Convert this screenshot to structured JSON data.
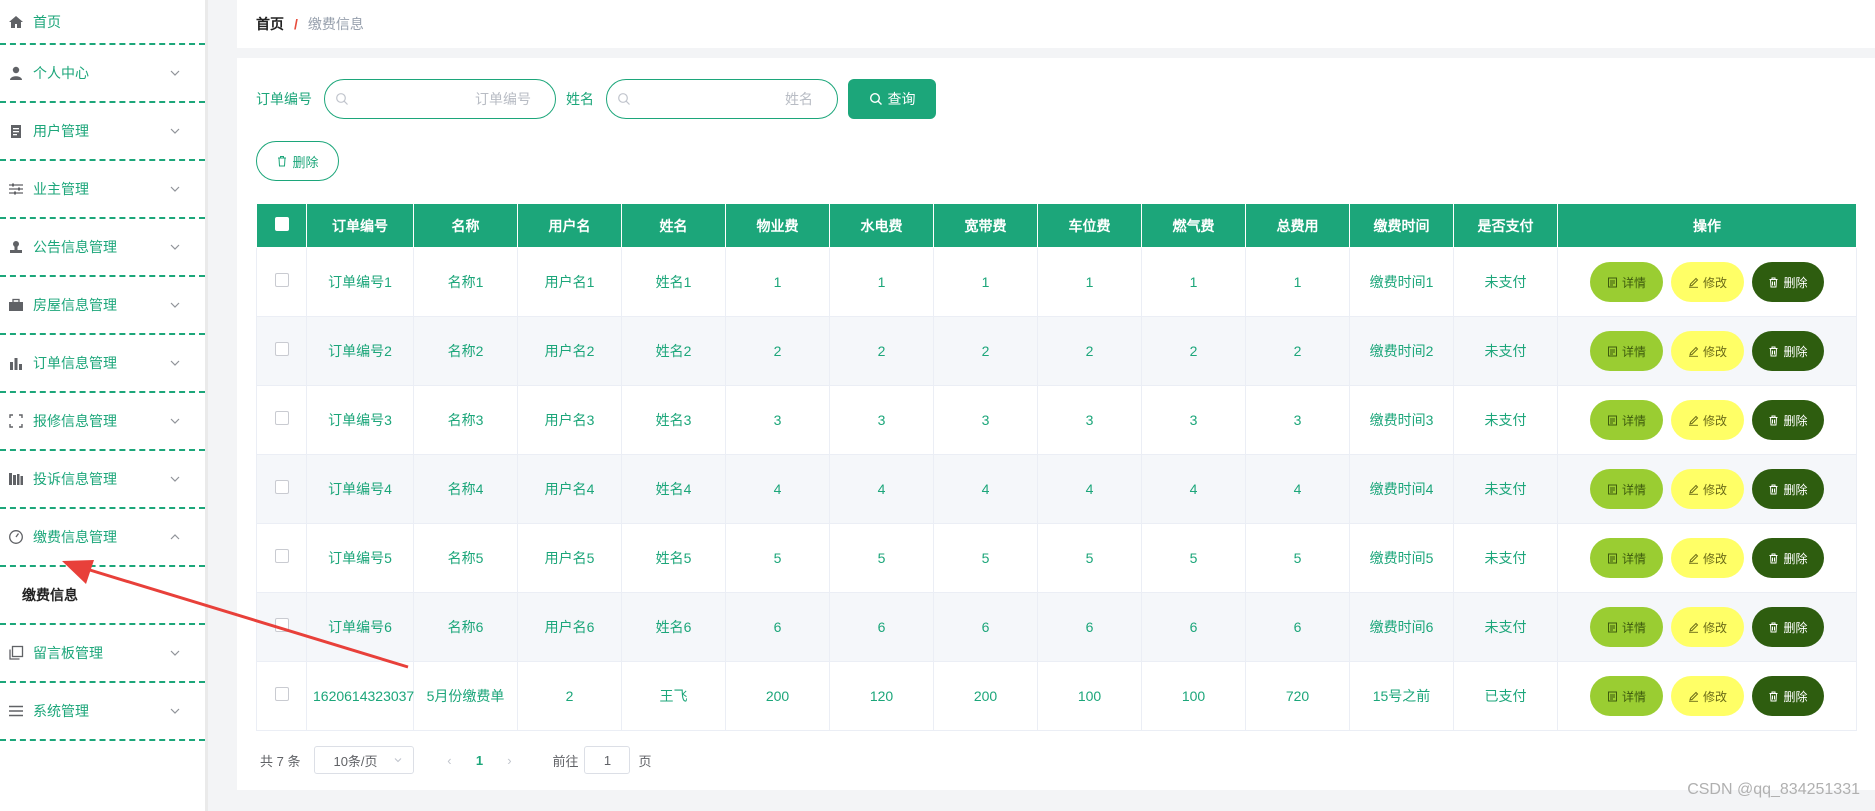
{
  "sidebar": {
    "items": [
      {
        "label": "首页",
        "icon": "home-icon"
      },
      {
        "label": "个人中心",
        "icon": "user-icon"
      },
      {
        "label": "用户管理",
        "icon": "clipboard-icon"
      },
      {
        "label": "业主管理",
        "icon": "sliders-icon"
      },
      {
        "label": "公告信息管理",
        "icon": "stamp-icon"
      },
      {
        "label": "房屋信息管理",
        "icon": "briefcase-icon"
      },
      {
        "label": "订单信息管理",
        "icon": "bar-chart-icon"
      },
      {
        "label": "报修信息管理",
        "icon": "crop-frame-icon"
      },
      {
        "label": "投诉信息管理",
        "icon": "books-icon"
      },
      {
        "label": "缴费信息管理",
        "icon": "gauge-icon"
      },
      {
        "label": "留言板管理",
        "icon": "copy-icon"
      },
      {
        "label": "系统管理",
        "icon": "list-icon"
      }
    ],
    "submenu": {
      "label": "缴费信息"
    }
  },
  "breadcrumb": {
    "home": "首页",
    "separator": "/",
    "current": "缴费信息"
  },
  "search": {
    "order_label": "订单编号",
    "order_placeholder": "订单编号",
    "name_label": "姓名",
    "name_placeholder": "姓名",
    "query_button": "查询"
  },
  "toolbar": {
    "delete_label": "删除"
  },
  "table": {
    "columns": [
      "订单编号",
      "名称",
      "用户名",
      "姓名",
      "物业费",
      "水电费",
      "宽带费",
      "车位费",
      "燃气费",
      "总费用",
      "缴费时间",
      "是否支付",
      "操作"
    ],
    "rows": [
      [
        "订单编号1",
        "名称1",
        "用户名1",
        "姓名1",
        "1",
        "1",
        "1",
        "1",
        "1",
        "1",
        "缴费时间1",
        "未支付"
      ],
      [
        "订单编号2",
        "名称2",
        "用户名2",
        "姓名2",
        "2",
        "2",
        "2",
        "2",
        "2",
        "2",
        "缴费时间2",
        "未支付"
      ],
      [
        "订单编号3",
        "名称3",
        "用户名3",
        "姓名3",
        "3",
        "3",
        "3",
        "3",
        "3",
        "3",
        "缴费时间3",
        "未支付"
      ],
      [
        "订单编号4",
        "名称4",
        "用户名4",
        "姓名4",
        "4",
        "4",
        "4",
        "4",
        "4",
        "4",
        "缴费时间4",
        "未支付"
      ],
      [
        "订单编号5",
        "名称5",
        "用户名5",
        "姓名5",
        "5",
        "5",
        "5",
        "5",
        "5",
        "5",
        "缴费时间5",
        "未支付"
      ],
      [
        "订单编号6",
        "名称6",
        "用户名6",
        "姓名6",
        "6",
        "6",
        "6",
        "6",
        "6",
        "6",
        "缴费时间6",
        "未支付"
      ],
      [
        "1620614323037",
        "5月份缴费单",
        "2",
        "王飞",
        "200",
        "120",
        "200",
        "100",
        "100",
        "720",
        "15号之前",
        "已支付"
      ]
    ],
    "actions": {
      "detail": "详情",
      "edit": "修改",
      "delete": "删除"
    }
  },
  "pagination": {
    "total": "共 7 条",
    "page_size": "10条/页",
    "current_page": "1",
    "goto_label": "前往",
    "goto_value": "1",
    "page_suffix": "页"
  },
  "colors": {
    "accent": "#1ca67a",
    "detail": "#9acd32",
    "edit": "#ffff66",
    "delete": "#2e5d0f",
    "arrow": "#e8403a"
  },
  "watermark": "CSDN @qq_834251331"
}
